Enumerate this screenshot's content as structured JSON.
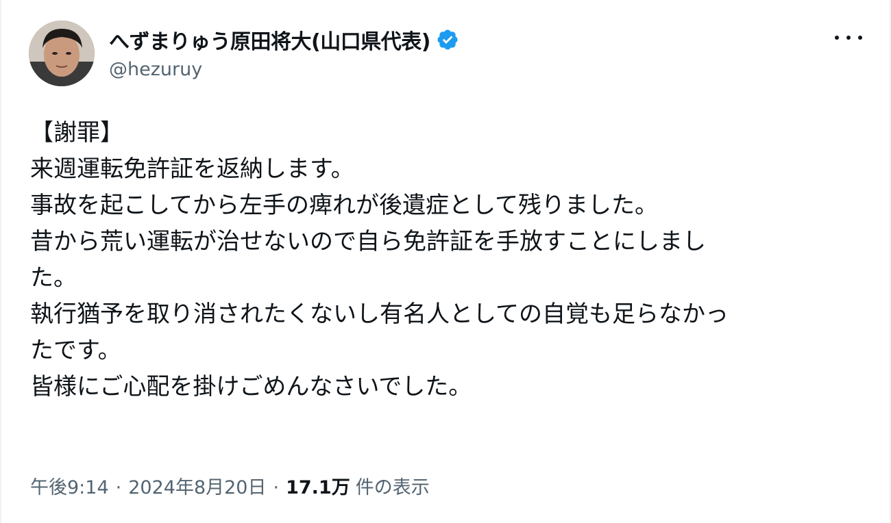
{
  "author": {
    "display_name": "へずまりゅう原田将大(山口県代表)",
    "handle": "@hezuruy",
    "verified_color": "#1d9bf0"
  },
  "tweet": {
    "lines": [
      "【謝罪】",
      "来週運転免許証を返納します。",
      "事故を起こしてから左手の痺れが後遺症として残りました。",
      "昔から荒い運転が治せないので自ら免許証を手放すことにしまし",
      "た。",
      "執行猶予を取り消されたくないし有名人としての自覚も足らなかっ",
      "たです。",
      "皆様にご心配を掛けごめんなさいでした。"
    ]
  },
  "meta": {
    "time": "午後9:14",
    "separator": "·",
    "date": "2024年8月20日",
    "views_count": "17.1万",
    "views_label": "件の表示"
  }
}
